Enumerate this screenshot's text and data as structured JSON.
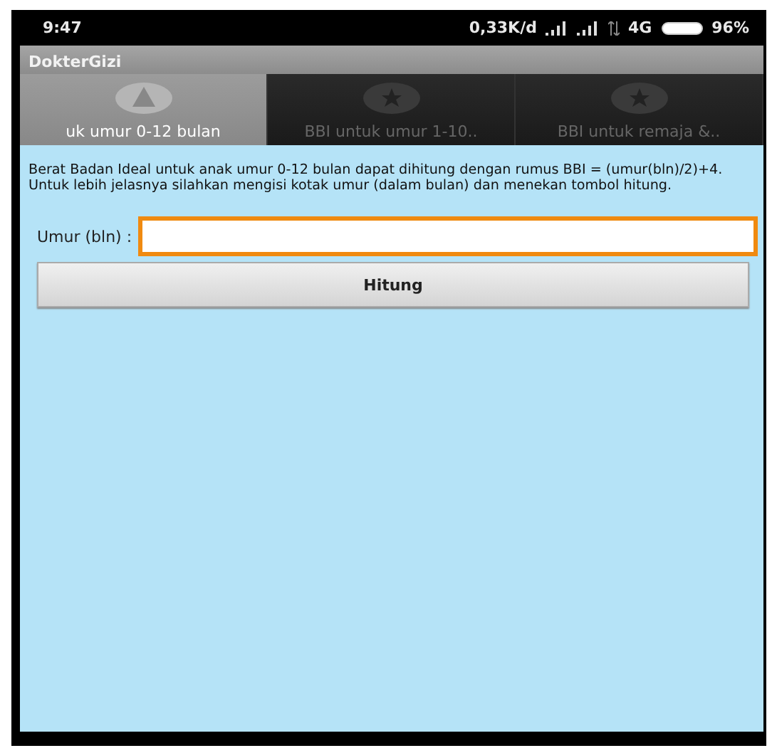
{
  "status_bar": {
    "time": "9:47",
    "speed": "0,33K/d",
    "network": "4G",
    "battery": "96%"
  },
  "app_bar": {
    "title": "DokterGizi"
  },
  "tabs": [
    {
      "label": "uk umur 0-12 bulan",
      "selected": true,
      "kind": "triangle"
    },
    {
      "label": "BBI untuk umur 1-10..",
      "selected": false,
      "kind": "star"
    },
    {
      "label": "BBI untuk remaja &..",
      "selected": false,
      "kind": "star"
    }
  ],
  "description": "Berat Badan Ideal untuk anak umur 0-12 bulan dapat dihitung dengan rumus BBI = (umur(bln)/2)+4. Untuk lebih jelasnya silahkan mengisi kotak umur (dalam bulan) dan menekan tombol hitung.",
  "age_field": {
    "label": "Umur (bln) :",
    "focused": true
  },
  "button": "Hitung"
}
